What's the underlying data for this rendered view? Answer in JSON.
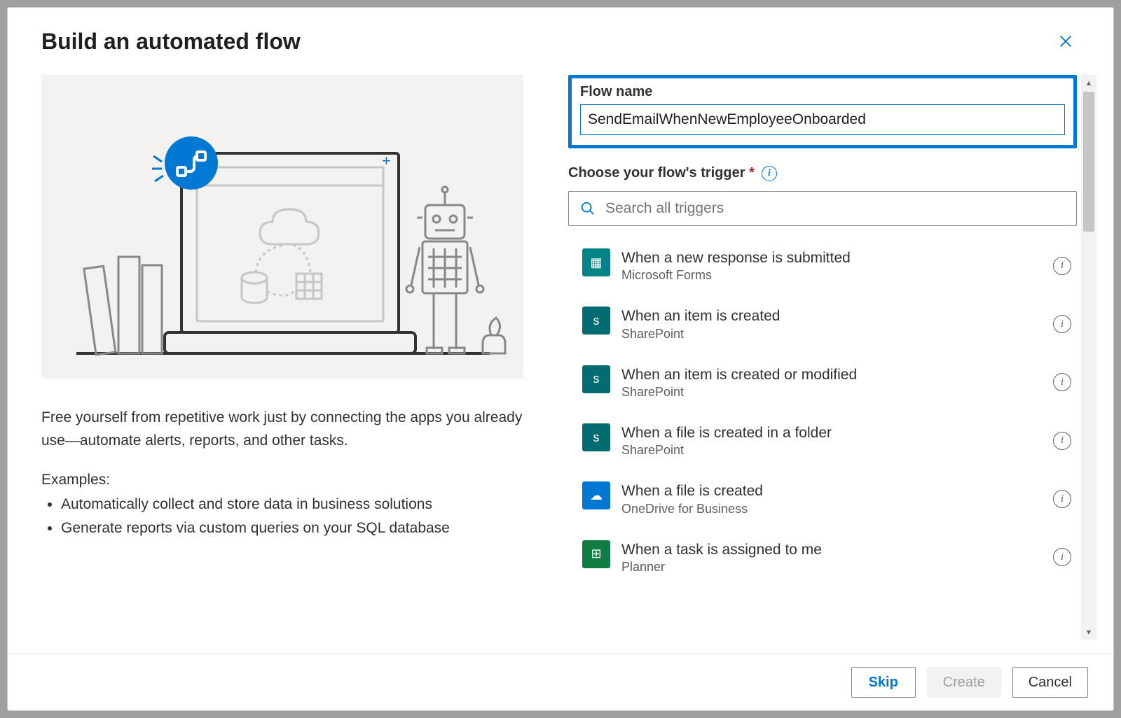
{
  "header": {
    "title": "Build an automated flow"
  },
  "left": {
    "description": "Free yourself from repetitive work just by connecting the apps you already use—automate alerts, reports, and other tasks.",
    "examples_label": "Examples:",
    "examples": [
      "Automatically collect and store data in business solutions",
      "Generate reports via custom queries on your SQL database"
    ]
  },
  "form": {
    "flow_name_label": "Flow name",
    "flow_name_value": "SendEmailWhenNewEmployeeOnboarded",
    "trigger_label": "Choose your flow's trigger",
    "required_mark": "*",
    "search_placeholder": "Search all triggers"
  },
  "triggers": [
    {
      "title": "When a new response is submitted",
      "source": "Microsoft Forms",
      "color": "#038387",
      "glyph": "▦"
    },
    {
      "title": "When an item is created",
      "source": "SharePoint",
      "color": "#036c70",
      "glyph": "s"
    },
    {
      "title": "When an item is created or modified",
      "source": "SharePoint",
      "color": "#036c70",
      "glyph": "s"
    },
    {
      "title": "When a file is created in a folder",
      "source": "SharePoint",
      "color": "#036c70",
      "glyph": "s"
    },
    {
      "title": "When a file is created",
      "source": "OneDrive for Business",
      "color": "#0078d4",
      "glyph": "☁"
    },
    {
      "title": "When a task is assigned to me",
      "source": "Planner",
      "color": "#107c41",
      "glyph": "⊞"
    }
  ],
  "footer": {
    "skip": "Skip",
    "create": "Create",
    "cancel": "Cancel"
  }
}
